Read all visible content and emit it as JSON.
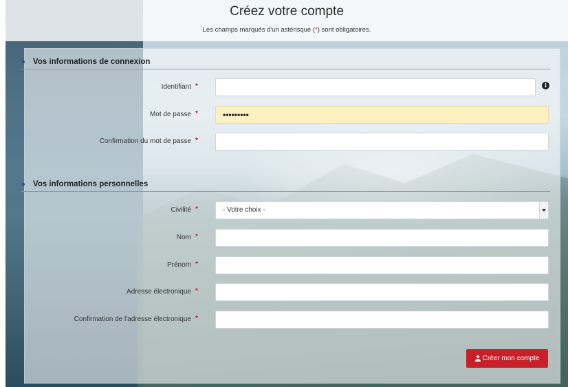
{
  "header": {
    "title": "Créez votre compte",
    "subtitle_before": "Les champs marqués d'un astérisque (",
    "subtitle_star": "*",
    "subtitle_after": ") sont obligatoires."
  },
  "sections": {
    "login": "Vos informations de connexion",
    "personal": "Vos informations personnelles"
  },
  "required_marker": "*",
  "fields": {
    "identifiant": {
      "label": "Identifiant",
      "value": ""
    },
    "password": {
      "label": "Mot de passe",
      "value": "•••••••••"
    },
    "password_confirm": {
      "label": "Confirmation du mot de passe",
      "value": ""
    },
    "civilite": {
      "label": "Civilité",
      "selected": "- Votre choix -"
    },
    "nom": {
      "label": "Nom",
      "value": ""
    },
    "prenom": {
      "label": "Prénom",
      "value": ""
    },
    "email": {
      "label": "Adresse électronique",
      "value": ""
    },
    "email_confirm": {
      "label": "Confirmation de l'adresse électronique",
      "value": ""
    }
  },
  "info_icon": "info-circle-icon",
  "submit": {
    "label": "Créer mon compte",
    "icon": "user-icon"
  },
  "colors": {
    "accent": "#c8202a",
    "autofill": "#fdf1c2"
  }
}
